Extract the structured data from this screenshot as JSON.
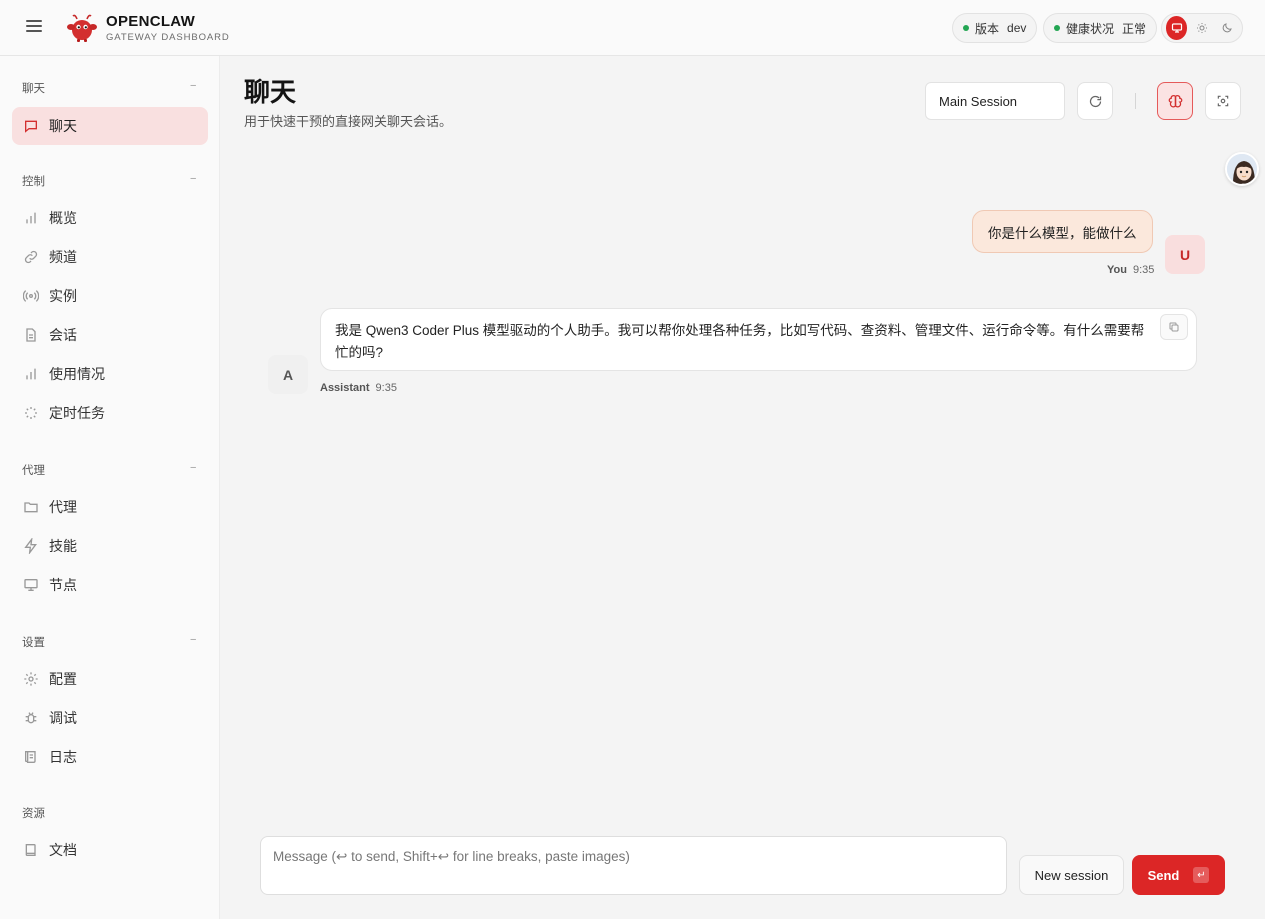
{
  "header": {
    "brand_title": "OPENCLAW",
    "brand_subtitle": "GATEWAY DASHBOARD",
    "version_label": "版本",
    "version_value": "dev",
    "health_label": "健康状况",
    "health_value": "正常",
    "status_color": "#22a552"
  },
  "sidebar": {
    "sections": [
      {
        "title": "聊天",
        "toggle": "−"
      },
      {
        "title": "控制",
        "toggle": "−"
      },
      {
        "title": "代理",
        "toggle": "−"
      },
      {
        "title": "设置",
        "toggle": "−"
      },
      {
        "title": "资源"
      }
    ],
    "items": [
      {
        "label": "聊天",
        "icon": "message-icon"
      },
      {
        "label": "概览",
        "icon": "bar-chart-icon"
      },
      {
        "label": "频道",
        "icon": "link-icon"
      },
      {
        "label": "实例",
        "icon": "radio-icon"
      },
      {
        "label": "会话",
        "icon": "file-icon"
      },
      {
        "label": "使用情况",
        "icon": "bar-chart-icon"
      },
      {
        "label": "定时任务",
        "icon": "loader-icon"
      },
      {
        "label": "代理",
        "icon": "folder-icon"
      },
      {
        "label": "技能",
        "icon": "zap-icon"
      },
      {
        "label": "节点",
        "icon": "monitor-icon"
      },
      {
        "label": "配置",
        "icon": "gear-icon"
      },
      {
        "label": "调试",
        "icon": "bug-icon"
      },
      {
        "label": "日志",
        "icon": "scroll-icon"
      },
      {
        "label": "文档",
        "icon": "book-icon"
      }
    ]
  },
  "main": {
    "title": "聊天",
    "subtitle": "用于快速干预的直接网关聊天会话。",
    "session_select": "Main Session"
  },
  "messages": [
    {
      "role_label": "You",
      "avatar": "U",
      "text": "你是什么模型，能做什么",
      "time": "9:35"
    },
    {
      "role_label": "Assistant",
      "avatar": "A",
      "text": "我是 Qwen3 Coder Plus 模型驱动的个人助手。我可以帮你处理各种任务，比如写代码、查资料、管理文件、运行命令等。有什么需要帮忙的吗?",
      "time": "9:35"
    }
  ],
  "composer": {
    "placeholder": "Message (↩ to send, Shift+↩ for line breaks, paste images)",
    "new_session_label": "New session",
    "send_label": "Send",
    "send_key": "↵"
  },
  "colors": {
    "accent": "#dc2626",
    "user_bubble": "#fbe8dc",
    "active_nav": "#f9e0e0"
  }
}
